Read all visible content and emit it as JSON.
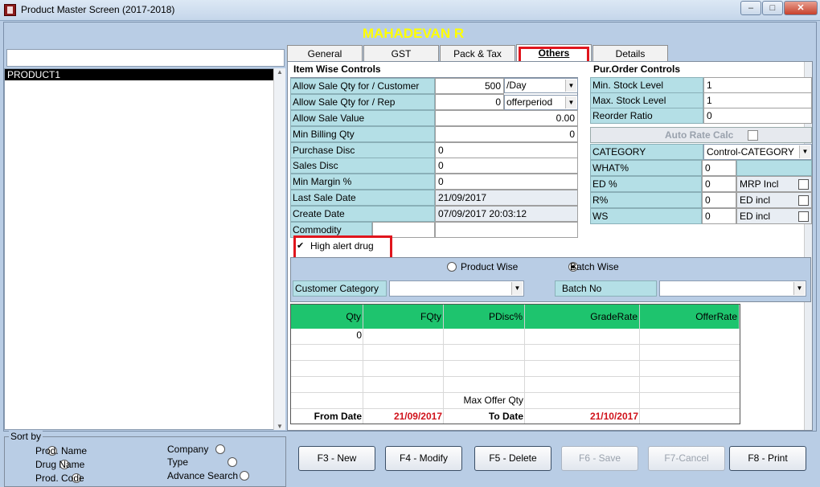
{
  "window": {
    "title": "Product Master Screen (2017-2018)",
    "min": "–",
    "max": "□",
    "close": "✕"
  },
  "company": "MAHADEVAN R",
  "search": {
    "value": ""
  },
  "products": [
    "PRODUCT1"
  ],
  "tabs": [
    "General",
    "GST",
    "Pack & Tax",
    "Others",
    "Details"
  ],
  "item_controls": {
    "heading": "Item Wise Controls",
    "rows": [
      {
        "label": "Allow Sale Qty for / Customer",
        "value": "500",
        "unit": "/Day"
      },
      {
        "label": "Allow Sale Qty for / Rep",
        "value": "0",
        "unit": "offerperiod"
      },
      {
        "label": "Allow Sale Value",
        "value": "0.00"
      },
      {
        "label": "Min Billing Qty",
        "value": "0"
      },
      {
        "label": "Purchase Disc",
        "value": "0"
      },
      {
        "label": "Sales Disc",
        "value": "0"
      },
      {
        "label": "Min Margin %",
        "value": "0"
      },
      {
        "label": "Last Sale Date",
        "value": "21/09/2017"
      },
      {
        "label": "Create Date",
        "value": "07/09/2017 20:03:12"
      },
      {
        "label": "Commodity",
        "value": ""
      }
    ]
  },
  "high_alert": {
    "label": "High alert drug",
    "checked": "✔"
  },
  "pur_controls": {
    "heading": "Pur.Order Controls",
    "rows": [
      {
        "label": "Min. Stock Level",
        "value": "1"
      },
      {
        "label": "Max. Stock Level",
        "value": "1"
      },
      {
        "label": "Reorder Ratio",
        "value": "0"
      }
    ]
  },
  "auto_rate": "Auto Rate Calc",
  "category": {
    "label": "CATEGORY",
    "value": "Control-CATEGORY"
  },
  "attr_rows": [
    {
      "label": "WHAT%",
      "value": "0",
      "extra": ""
    },
    {
      "label": "ED %",
      "value": "0",
      "extra": "MRP Incl"
    },
    {
      "label": "R%",
      "value": "0",
      "extra": "ED incl"
    },
    {
      "label": "WS",
      "value": "0",
      "extra": "ED incl"
    }
  ],
  "offer": {
    "product_wise": "Product Wise",
    "batch_wise": "Batch Wise",
    "customer_category": "Customer Category",
    "batch_no": "Batch No",
    "columns": [
      "Qty",
      "FQty",
      "PDisc%",
      "GradeRate",
      "OfferRate"
    ],
    "first_qty": "0",
    "max_offer_qty": "Max Offer Qty",
    "from_date_label": "From Date",
    "from_date": "21/09/2017",
    "to_date_label": "To Date",
    "to_date": "21/10/2017"
  },
  "sort": {
    "legend": "Sort by",
    "options": [
      "Prod. Name",
      "Drug Name",
      "Prod. Code",
      "Company",
      "Type",
      "Advance Search"
    ]
  },
  "buttons": [
    "F3 - New",
    "F4 - Modify",
    "F5 - Delete",
    "F6 - Save",
    "F7-Cancel",
    "F8 - Print"
  ],
  "colors": {
    "accent_green": "#1ec46e",
    "highlight_red": "#e0151d",
    "date_red": "#d0121b",
    "company_yellow": "#ffff00"
  }
}
